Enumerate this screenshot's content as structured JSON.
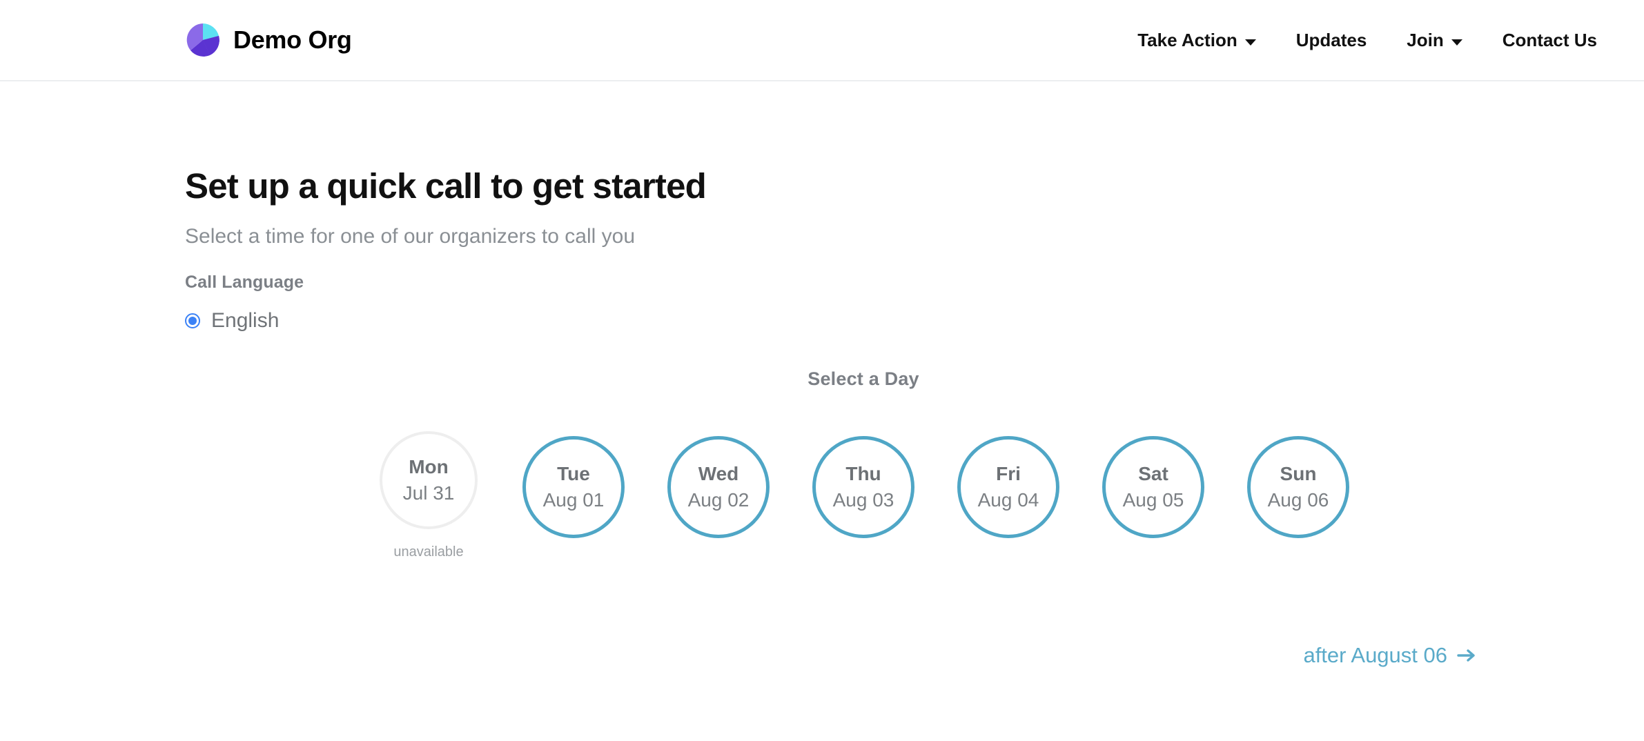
{
  "header": {
    "brand": {
      "name": "Demo Org",
      "logo_icon": "pie-chart-logo-icon",
      "logo_colors": {
        "top_right": "#5ce1f2",
        "left": "#8b6ae8",
        "bottom_left": "#7d5be0",
        "bottom_right": "#5b33d1"
      }
    },
    "nav": [
      {
        "label": "Take Action",
        "has_dropdown": true
      },
      {
        "label": "Updates",
        "has_dropdown": false
      },
      {
        "label": "Join",
        "has_dropdown": true
      },
      {
        "label": "Contact Us",
        "has_dropdown": false
      }
    ]
  },
  "main": {
    "title": "Set up a quick call to get started",
    "subtitle": "Select a time for one of our organizers to call you",
    "call_language": {
      "label": "Call Language",
      "options": [
        {
          "label": "English",
          "selected": true
        }
      ]
    },
    "day_picker": {
      "heading": "Select a Day",
      "days": [
        {
          "dow": "Mon",
          "date": "Jul 31",
          "available": false,
          "note": "unavailable"
        },
        {
          "dow": "Tue",
          "date": "Aug 01",
          "available": true,
          "note": ""
        },
        {
          "dow": "Wed",
          "date": "Aug 02",
          "available": true,
          "note": ""
        },
        {
          "dow": "Thu",
          "date": "Aug 03",
          "available": true,
          "note": ""
        },
        {
          "dow": "Fri",
          "date": "Aug 04",
          "available": true,
          "note": ""
        },
        {
          "dow": "Sat",
          "date": "Aug 05",
          "available": true,
          "note": ""
        },
        {
          "dow": "Sun",
          "date": "Aug 06",
          "available": true,
          "note": ""
        }
      ]
    },
    "next_link": {
      "label": "after August 06",
      "icon": "arrow-right-icon"
    }
  },
  "colors": {
    "accent_teal": "#4fa6c6",
    "link_teal": "#5aaac9",
    "radio_blue": "#3b82f6",
    "muted_gray": "#7b7f85",
    "disabled_border": "#eeeeee"
  }
}
